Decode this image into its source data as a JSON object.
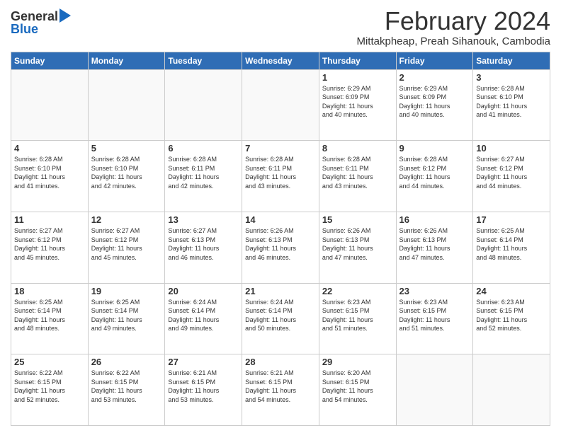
{
  "header": {
    "logo_general": "General",
    "logo_blue": "Blue",
    "title": "February 2024",
    "subtitle": "Mittakpheap, Preah Sihanouk, Cambodia"
  },
  "days_header": [
    "Sunday",
    "Monday",
    "Tuesday",
    "Wednesday",
    "Thursday",
    "Friday",
    "Saturday"
  ],
  "weeks": [
    [
      {
        "day": "",
        "info": ""
      },
      {
        "day": "",
        "info": ""
      },
      {
        "day": "",
        "info": ""
      },
      {
        "day": "",
        "info": ""
      },
      {
        "day": "1",
        "info": "Sunrise: 6:29 AM\nSunset: 6:09 PM\nDaylight: 11 hours\nand 40 minutes."
      },
      {
        "day": "2",
        "info": "Sunrise: 6:29 AM\nSunset: 6:09 PM\nDaylight: 11 hours\nand 40 minutes."
      },
      {
        "day": "3",
        "info": "Sunrise: 6:28 AM\nSunset: 6:10 PM\nDaylight: 11 hours\nand 41 minutes."
      }
    ],
    [
      {
        "day": "4",
        "info": "Sunrise: 6:28 AM\nSunset: 6:10 PM\nDaylight: 11 hours\nand 41 minutes."
      },
      {
        "day": "5",
        "info": "Sunrise: 6:28 AM\nSunset: 6:10 PM\nDaylight: 11 hours\nand 42 minutes."
      },
      {
        "day": "6",
        "info": "Sunrise: 6:28 AM\nSunset: 6:11 PM\nDaylight: 11 hours\nand 42 minutes."
      },
      {
        "day": "7",
        "info": "Sunrise: 6:28 AM\nSunset: 6:11 PM\nDaylight: 11 hours\nand 43 minutes."
      },
      {
        "day": "8",
        "info": "Sunrise: 6:28 AM\nSunset: 6:11 PM\nDaylight: 11 hours\nand 43 minutes."
      },
      {
        "day": "9",
        "info": "Sunrise: 6:28 AM\nSunset: 6:12 PM\nDaylight: 11 hours\nand 44 minutes."
      },
      {
        "day": "10",
        "info": "Sunrise: 6:27 AM\nSunset: 6:12 PM\nDaylight: 11 hours\nand 44 minutes."
      }
    ],
    [
      {
        "day": "11",
        "info": "Sunrise: 6:27 AM\nSunset: 6:12 PM\nDaylight: 11 hours\nand 45 minutes."
      },
      {
        "day": "12",
        "info": "Sunrise: 6:27 AM\nSunset: 6:12 PM\nDaylight: 11 hours\nand 45 minutes."
      },
      {
        "day": "13",
        "info": "Sunrise: 6:27 AM\nSunset: 6:13 PM\nDaylight: 11 hours\nand 46 minutes."
      },
      {
        "day": "14",
        "info": "Sunrise: 6:26 AM\nSunset: 6:13 PM\nDaylight: 11 hours\nand 46 minutes."
      },
      {
        "day": "15",
        "info": "Sunrise: 6:26 AM\nSunset: 6:13 PM\nDaylight: 11 hours\nand 47 minutes."
      },
      {
        "day": "16",
        "info": "Sunrise: 6:26 AM\nSunset: 6:13 PM\nDaylight: 11 hours\nand 47 minutes."
      },
      {
        "day": "17",
        "info": "Sunrise: 6:25 AM\nSunset: 6:14 PM\nDaylight: 11 hours\nand 48 minutes."
      }
    ],
    [
      {
        "day": "18",
        "info": "Sunrise: 6:25 AM\nSunset: 6:14 PM\nDaylight: 11 hours\nand 48 minutes."
      },
      {
        "day": "19",
        "info": "Sunrise: 6:25 AM\nSunset: 6:14 PM\nDaylight: 11 hours\nand 49 minutes."
      },
      {
        "day": "20",
        "info": "Sunrise: 6:24 AM\nSunset: 6:14 PM\nDaylight: 11 hours\nand 49 minutes."
      },
      {
        "day": "21",
        "info": "Sunrise: 6:24 AM\nSunset: 6:14 PM\nDaylight: 11 hours\nand 50 minutes."
      },
      {
        "day": "22",
        "info": "Sunrise: 6:23 AM\nSunset: 6:15 PM\nDaylight: 11 hours\nand 51 minutes."
      },
      {
        "day": "23",
        "info": "Sunrise: 6:23 AM\nSunset: 6:15 PM\nDaylight: 11 hours\nand 51 minutes."
      },
      {
        "day": "24",
        "info": "Sunrise: 6:23 AM\nSunset: 6:15 PM\nDaylight: 11 hours\nand 52 minutes."
      }
    ],
    [
      {
        "day": "25",
        "info": "Sunrise: 6:22 AM\nSunset: 6:15 PM\nDaylight: 11 hours\nand 52 minutes."
      },
      {
        "day": "26",
        "info": "Sunrise: 6:22 AM\nSunset: 6:15 PM\nDaylight: 11 hours\nand 53 minutes."
      },
      {
        "day": "27",
        "info": "Sunrise: 6:21 AM\nSunset: 6:15 PM\nDaylight: 11 hours\nand 53 minutes."
      },
      {
        "day": "28",
        "info": "Sunrise: 6:21 AM\nSunset: 6:15 PM\nDaylight: 11 hours\nand 54 minutes."
      },
      {
        "day": "29",
        "info": "Sunrise: 6:20 AM\nSunset: 6:15 PM\nDaylight: 11 hours\nand 54 minutes."
      },
      {
        "day": "",
        "info": ""
      },
      {
        "day": "",
        "info": ""
      }
    ]
  ]
}
